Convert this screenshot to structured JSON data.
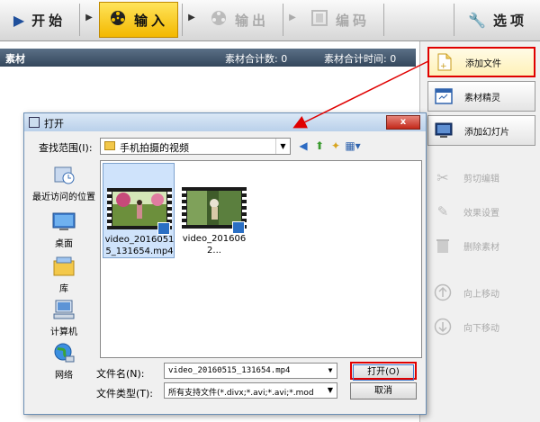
{
  "toolbar": {
    "start": "开始",
    "input": "输入",
    "output": "输出",
    "encode": "编码",
    "options": "选项"
  },
  "header": {
    "title": "素材",
    "count_label": "素材合计数: 0",
    "time_label": "素材合计时间: 0"
  },
  "side": {
    "add_file": "添加文件",
    "elite": "素材精灵",
    "add_slide": "添加幻灯片",
    "cut_edit": "剪切编辑",
    "effects": "效果设置",
    "delete": "删除素材",
    "move_up": "向上移动",
    "move_down": "向下移动"
  },
  "dialog": {
    "title": "打开",
    "close": "x",
    "look_in_label": "查找范围(I):",
    "look_in_value": "手机拍摄的视频",
    "places": [
      "最近访问的位置",
      "桌面",
      "库",
      "计算机",
      "网络"
    ],
    "files": [
      {
        "name": "video_20160515_131654.mp4"
      },
      {
        "name": "video_2016062..."
      }
    ],
    "filename_label": "文件名(N):",
    "filename_value": "video_20160515_131654.mp4",
    "filetype_label": "文件类型(T):",
    "filetype_value": "所有支持文件(*.divx;*.avi;*.avi;*.mod",
    "open_button": "打开(O)",
    "cancel_button": "取消"
  },
  "colors": {
    "highlight": "#e00000",
    "accent_yellow": "#f3b800"
  }
}
